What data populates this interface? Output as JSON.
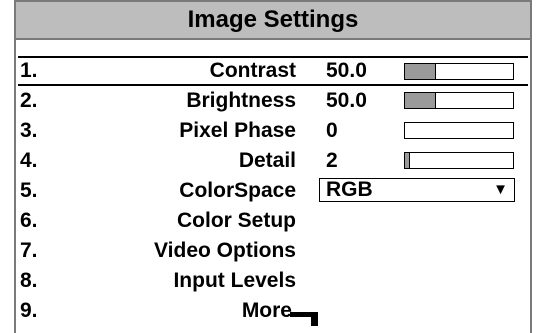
{
  "title": "Image Settings",
  "items": [
    {
      "num": "1.",
      "label": "Contrast",
      "value": "50.0",
      "level": 0.28
    },
    {
      "num": "2.",
      "label": "Brightness",
      "value": "50.0",
      "level": 0.28
    },
    {
      "num": "3.",
      "label": "Pixel Phase",
      "value": "0",
      "level": 0.0
    },
    {
      "num": "4.",
      "label": "Detail",
      "value": "2",
      "level": 0.04
    },
    {
      "num": "5.",
      "label": "ColorSpace",
      "value": "RGB"
    },
    {
      "num": "6.",
      "label": "Color Setup"
    },
    {
      "num": "7.",
      "label": "Video Options"
    },
    {
      "num": "8.",
      "label": "Input Levels"
    },
    {
      "num": "9.",
      "label": "More"
    }
  ],
  "colors": {
    "title_bar": "#bdbdbd",
    "slider_fill": "#9a9a9a"
  },
  "icons": {
    "dropdown": "triangle-down-icon",
    "submenu": "submenu-corner-icon"
  }
}
